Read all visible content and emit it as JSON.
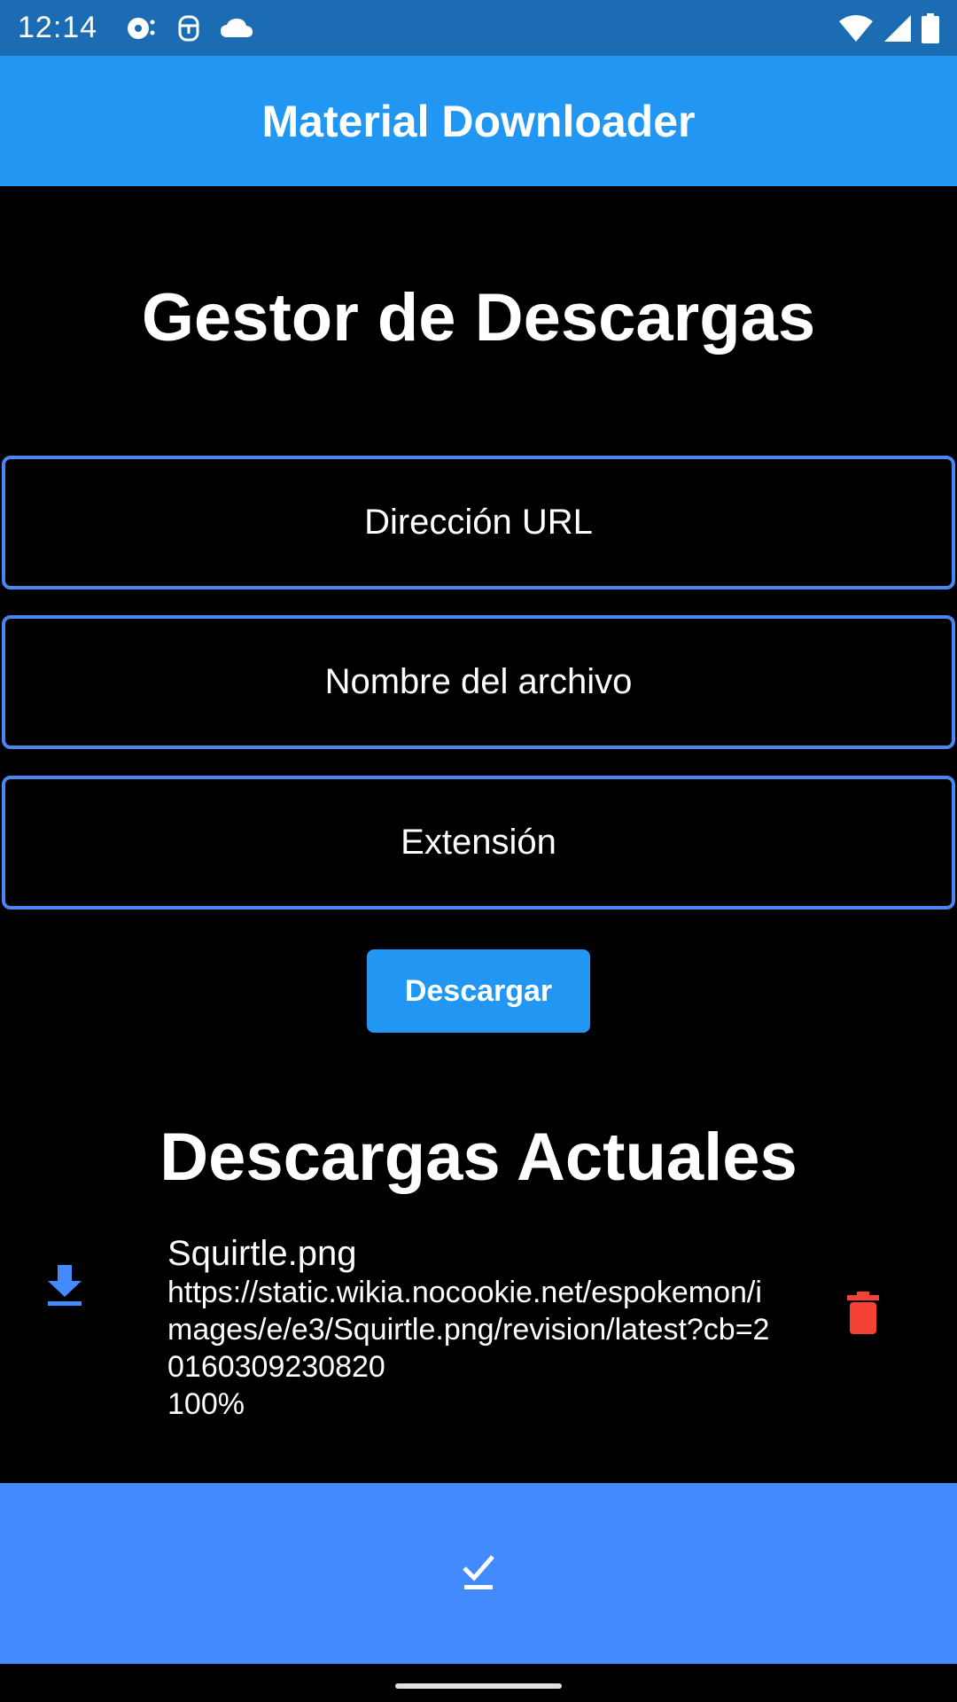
{
  "status_bar": {
    "time": "12:14",
    "left_icons": [
      "media-icon",
      "android-icon",
      "cloud-icon"
    ],
    "right_icons": [
      "wifi-icon",
      "signal-icon",
      "battery-icon"
    ]
  },
  "app_bar": {
    "title": "Material Downloader"
  },
  "main": {
    "heading": "Gestor de Descargas",
    "fields": {
      "url_placeholder": "Dirección URL",
      "name_placeholder": "Nombre del archivo",
      "ext_placeholder": "Extensión"
    },
    "download_button": "Descargar"
  },
  "downloads": {
    "heading": "Descargas Actuales",
    "items": [
      {
        "name": "Squirtle.png",
        "url": "https://static.wikia.nocookie.net/espokemon/images/e/e3/Squirtle.png/revision/latest?cb=20160309230820",
        "progress": "100%"
      }
    ]
  },
  "bottom_bar": {
    "icon": "done-check-icon"
  },
  "colors": {
    "status_bar": "#1b6cb3",
    "app_bar": "#2196f3",
    "field_border": "#4a86f0",
    "bottom_bar": "#448aff",
    "delete": "#f44336"
  }
}
